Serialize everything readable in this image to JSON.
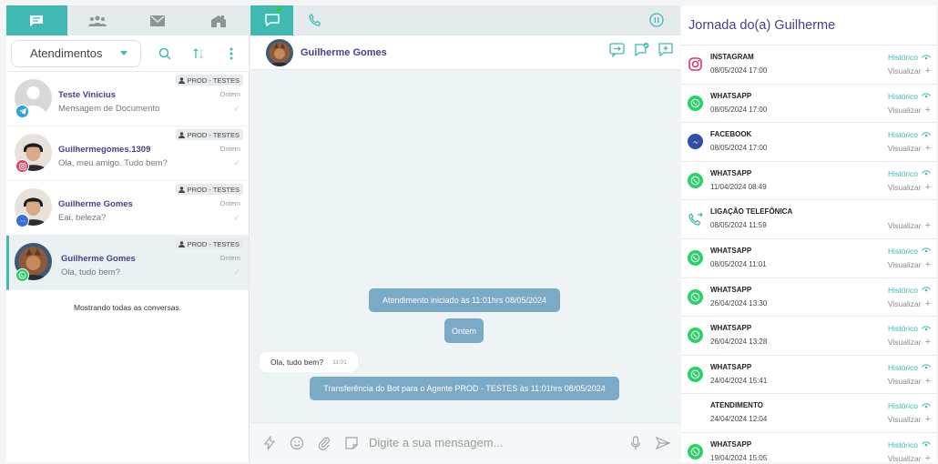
{
  "left": {
    "department": "Atendimentos",
    "conversations": [
      {
        "name": "Teste Vinicius",
        "message": "Mensagem de Documento",
        "time": "Ontem",
        "tag": "PROD - TESTES",
        "channel": "telegram",
        "avatar": "default"
      },
      {
        "name": "Guilhermegomes.1309",
        "message": "Ola, meu amigo. Tudo bem?",
        "time": "Ontem",
        "tag": "PROD - TESTES",
        "channel": "instagram",
        "avatar": "photo"
      },
      {
        "name": "Guilherme Gomes",
        "message": "Eai, beleza?",
        "time": "Ontem",
        "tag": "PROD - TESTES",
        "channel": "messenger",
        "avatar": "photo"
      },
      {
        "name": "Guilherme Gomes",
        "message": "Ola, tudo bem?",
        "time": "Ontem",
        "tag": "PROD - TESTES",
        "channel": "whatsapp",
        "avatar": "photo2"
      }
    ],
    "showing_all": "Mostrando todas as conversas."
  },
  "chat": {
    "contact_name": "Guilherme Gomes",
    "system_start": "Atendimento iniciado às 11:01hrs 08/05/2024",
    "date_pill": "Ontem",
    "message_text": "Ola, tudo bem?",
    "message_time": "11:01",
    "system_transfer": "Transferência do Bot para o Agente PROD - TESTES às 11:01hrs 08/05/2024",
    "input_placeholder": "Digite a sua mensagem..."
  },
  "journey": {
    "title": "Jornada do(a) Guilherme",
    "history_label": "Histórico",
    "view_label": "Visualizar",
    "events": [
      {
        "channel": "INSTAGRAM",
        "datetime": "08/05/2024 17:00",
        "icon": "instagram",
        "has_history": true
      },
      {
        "channel": "WHATSAPP",
        "datetime": "08/05/2024 17:00",
        "icon": "whatsapp",
        "has_history": true
      },
      {
        "channel": "FACEBOOK",
        "datetime": "08/05/2024 17:00",
        "icon": "messenger",
        "has_history": true
      },
      {
        "channel": "WHATSAPP",
        "datetime": "11/04/2024 08:49",
        "icon": "whatsapp",
        "has_history": true
      },
      {
        "channel": "LIGAÇÃO TELEFÔNICA",
        "datetime": "08/05/2024 11:59",
        "icon": "phone",
        "has_history": false
      },
      {
        "channel": "WHATSAPP",
        "datetime": "08/05/2024 11:01",
        "icon": "whatsapp",
        "has_history": true
      },
      {
        "channel": "WHATSAPP",
        "datetime": "26/04/2024 13:30",
        "icon": "whatsapp",
        "has_history": true
      },
      {
        "channel": "WHATSAPP",
        "datetime": "26/04/2024 13:28",
        "icon": "whatsapp",
        "has_history": true
      },
      {
        "channel": "WHATSAPP",
        "datetime": "24/04/2024 15:41",
        "icon": "whatsapp",
        "has_history": true
      },
      {
        "channel": "ATENDIMENTO",
        "datetime": "24/04/2024 12:04",
        "icon": "none",
        "has_history": true
      },
      {
        "channel": "WHATSAPP",
        "datetime": "19/04/2024 15:05",
        "icon": "whatsapp",
        "has_history": true
      }
    ]
  },
  "colors": {
    "accent": "#3fb9b1",
    "brand_purple": "#4a3d8f",
    "system_pill": "#7aaac5"
  }
}
